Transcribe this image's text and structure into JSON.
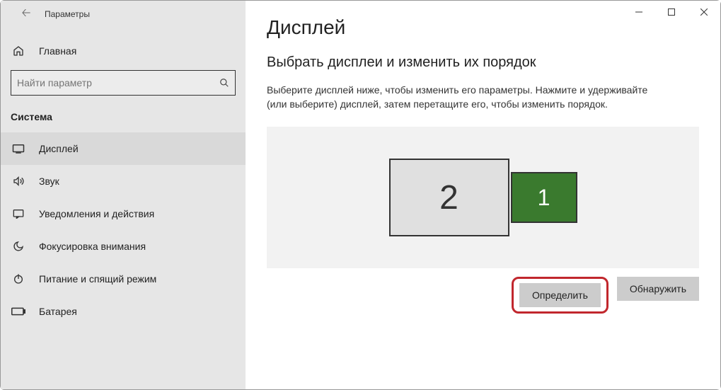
{
  "app_title": "Параметры",
  "search": {
    "placeholder": "Найти параметр"
  },
  "home_label": "Главная",
  "category_label": "Система",
  "sidebar": {
    "items": [
      {
        "label": "Дисплей"
      },
      {
        "label": "Звук"
      },
      {
        "label": "Уведомления и действия"
      },
      {
        "label": "Фокусировка внимания"
      },
      {
        "label": "Питание и спящий режим"
      },
      {
        "label": "Батарея"
      }
    ]
  },
  "page": {
    "title": "Дисплей",
    "section_title": "Выбрать дисплеи и изменить их порядок",
    "description": "Выберите дисплей ниже, чтобы изменить его параметры. Нажмите и удерживайте (или выберите) дисплей, затем перетащите его, чтобы изменить порядок.",
    "monitors": {
      "primary": "1",
      "secondary": "2"
    },
    "buttons": {
      "identify": "Определить",
      "detect": "Обнаружить"
    }
  }
}
